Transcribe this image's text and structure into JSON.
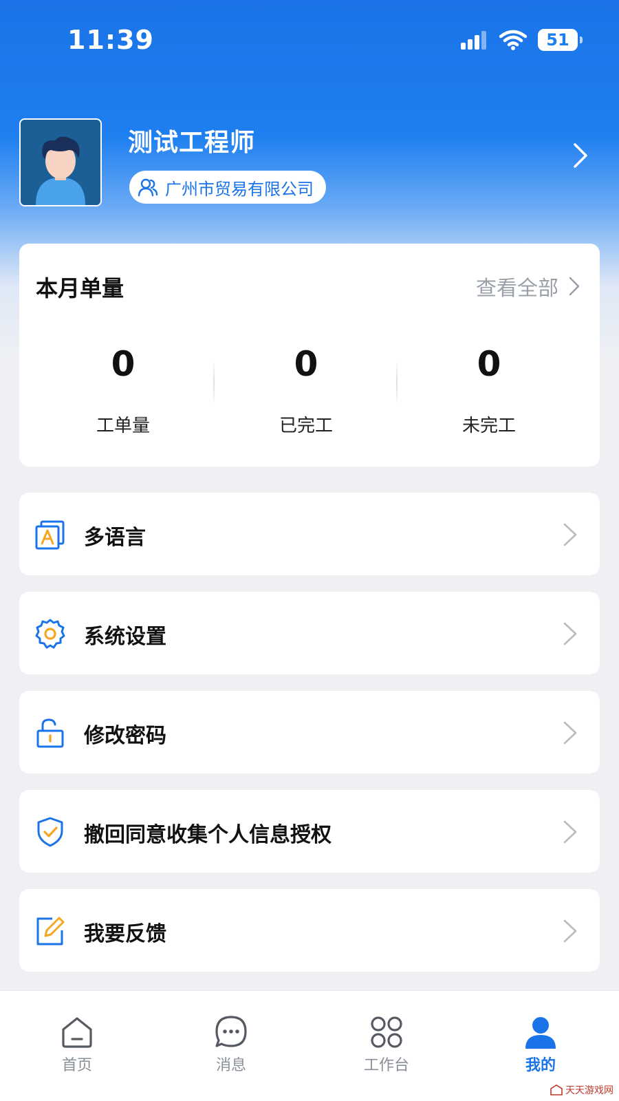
{
  "status_bar": {
    "time": "11:39",
    "battery": "51"
  },
  "profile": {
    "name": "测试工程师",
    "company": "广州市贸易有限公司"
  },
  "monthly": {
    "title": "本月单量",
    "view_all": "查看全部",
    "stats": [
      {
        "value": "0",
        "label": "工单量"
      },
      {
        "value": "0",
        "label": "已完工"
      },
      {
        "value": "0",
        "label": "未完工"
      }
    ]
  },
  "menu": [
    {
      "label": "多语言",
      "icon": "language-icon"
    },
    {
      "label": "系统设置",
      "icon": "gear-icon"
    },
    {
      "label": "修改密码",
      "icon": "unlock-icon"
    },
    {
      "label": "撤回同意收集个人信息授权",
      "icon": "shield-check-icon"
    },
    {
      "label": "我要反馈",
      "icon": "edit-icon"
    }
  ],
  "tabs": [
    {
      "label": "首页",
      "icon": "home-icon"
    },
    {
      "label": "消息",
      "icon": "message-icon"
    },
    {
      "label": "工作台",
      "icon": "grid-icon"
    },
    {
      "label": "我的",
      "icon": "user-icon",
      "active": true
    }
  ],
  "colors": {
    "primary": "#1a73e8",
    "accent": "#f5a623",
    "background": "#eef0f4"
  },
  "watermark": "天天游戏网"
}
